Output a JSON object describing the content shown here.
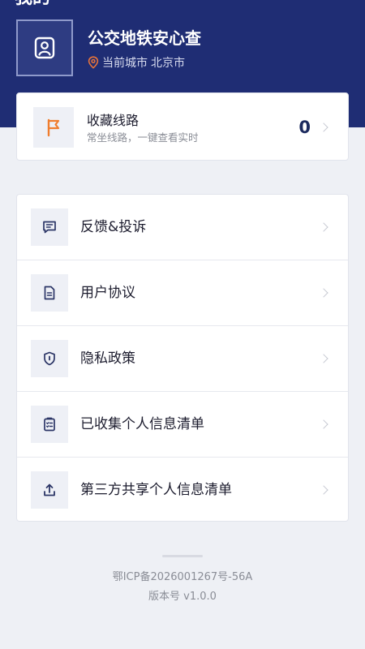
{
  "header": {
    "page_title": "我的",
    "app_name": "公交地铁安心查",
    "city_label": "当前城市",
    "city_name": "北京市",
    "avatar_icon": "user-badge-icon",
    "location_icon": "location-pin-icon",
    "location_icon_color": "#e8743a",
    "background_color": "#1f2d74"
  },
  "favorites": {
    "title": "收藏线路",
    "subtitle": "常坐线路，一键查看实时",
    "count": "0",
    "icon": "flag-icon",
    "icon_color": "#f07d2e"
  },
  "menu": {
    "items": [
      {
        "label": "反馈&投诉",
        "icon": "feedback-message-icon"
      },
      {
        "label": "用户协议",
        "icon": "document-icon"
      },
      {
        "label": "隐私政策",
        "icon": "shield-icon"
      },
      {
        "label": "已收集个人信息清单",
        "icon": "checklist-clipboard-icon"
      },
      {
        "label": "第三方共享个人信息清单",
        "icon": "share-upload-icon"
      }
    ]
  },
  "footer": {
    "icp": "鄂ICP备2026001267号-56A",
    "version": "版本号 v1.0.0"
  }
}
